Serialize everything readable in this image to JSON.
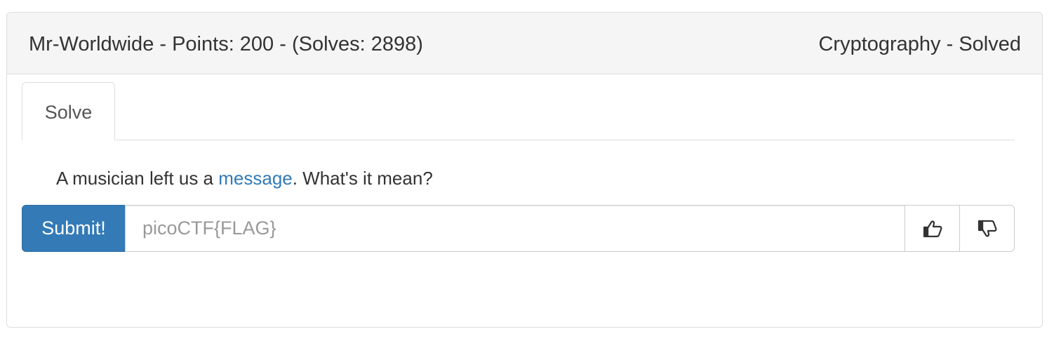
{
  "problem": {
    "title": "Mr-Worldwide - Points: 200 - (Solves: 2898)",
    "category_status": "Cryptography - Solved"
  },
  "tabs": [
    {
      "label": "Solve"
    }
  ],
  "description": {
    "prefix": "A musician left us a ",
    "link_text": "message",
    "suffix": ". What's it mean?"
  },
  "form": {
    "submit_label": "Submit!",
    "flag_placeholder": "picoCTF{FLAG}",
    "flag_value": ""
  },
  "icons": {
    "upvote": "thumbs-up-icon",
    "downvote": "thumbs-down-icon"
  },
  "colors": {
    "primary": "#337ab7",
    "link": "#337ab7",
    "heading_bg": "#f5f5f5",
    "border": "#dddddd"
  }
}
